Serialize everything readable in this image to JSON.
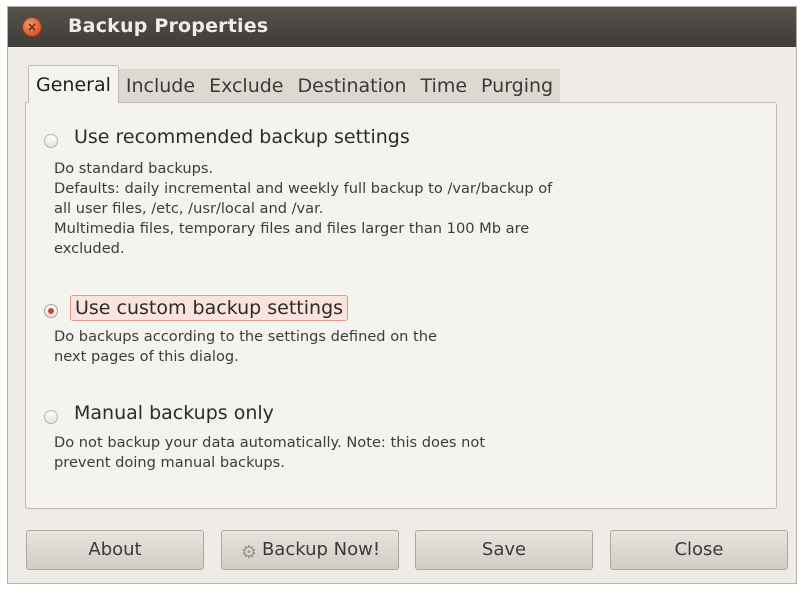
{
  "window": {
    "title": "Backup Properties",
    "close_icon": "close-icon"
  },
  "tabs": [
    {
      "label": "General",
      "active": true
    },
    {
      "label": "Include",
      "active": false
    },
    {
      "label": "Exclude",
      "active": false
    },
    {
      "label": "Destination",
      "active": false
    },
    {
      "label": "Time",
      "active": false
    },
    {
      "label": "Purging",
      "active": false
    }
  ],
  "options": [
    {
      "label": "Use recommended backup settings",
      "selected": false,
      "description": "Do standard backups.\nDefaults: daily incremental and weekly full backup to /var/backup of\nall user files, /etc, /usr/local and /var.\nMultimedia files, temporary files and files larger than 100 Mb are\nexcluded."
    },
    {
      "label": "Use custom backup settings",
      "selected": true,
      "description": "Do backups  according  to  the  settings  defined  on  the\nnext pages of this dialog."
    },
    {
      "label": "Manual backups only",
      "selected": false,
      "description": "Do not backup your data automatically. Note: this does not\nprevent doing manual backups."
    }
  ],
  "buttons": {
    "about": "About",
    "backup_now": "Backup Now!",
    "backup_now_icon": "gear-icon",
    "save": "Save",
    "close": "Close"
  },
  "colors": {
    "titlebar": "#4a4843",
    "radio_selected": "#d3452d",
    "focus_highlight": "#fbe4de",
    "window_bg": "#efebe7"
  }
}
